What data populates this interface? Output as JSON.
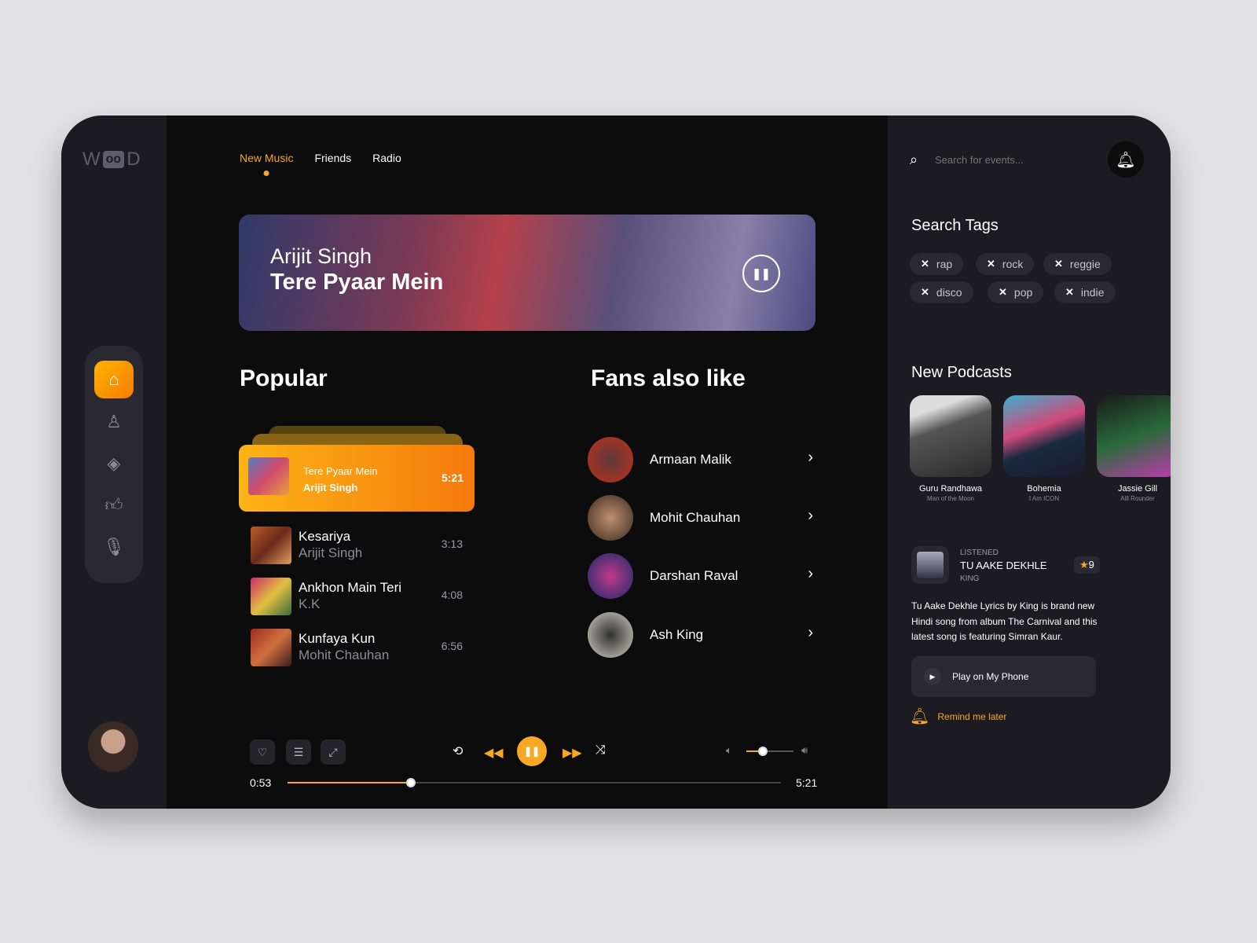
{
  "brand": {
    "logo": "WOOD",
    "colors": {
      "accent": "#f9a825",
      "panel": "#1c1b22",
      "main": "#0c0c0d"
    }
  },
  "sidebar": {
    "items": [
      {
        "icon": "home-icon",
        "active": true
      },
      {
        "icon": "user-icon"
      },
      {
        "icon": "layers-icon"
      },
      {
        "icon": "thumbs-up-icon"
      },
      {
        "icon": "microphone-icon"
      }
    ]
  },
  "tabs": [
    "New Music",
    "Friends",
    "Radio"
  ],
  "banner": {
    "artist": "Arijit Singh",
    "title": "Tere Pyaar Mein"
  },
  "popular": {
    "title": "Popular",
    "current": {
      "name": "Tere Pyaar Mein",
      "artist": "Arijit Singh",
      "duration": "5:21"
    },
    "songs": [
      {
        "name": "Kesariya",
        "artist": "Arijit Singh",
        "duration": "3:13"
      },
      {
        "name": "Ankhon Main Teri",
        "artist": "K.K",
        "duration": "4:08"
      },
      {
        "name": "Kunfaya Kun",
        "artist": "Mohit Chauhan",
        "duration": "6:56"
      }
    ]
  },
  "fans": {
    "title": "Fans also like",
    "items": [
      "Armaan Malik",
      "Mohit Chauhan",
      "Darshan Raval",
      "Ash King"
    ]
  },
  "player": {
    "elapsed": "0:53",
    "total": "5:21",
    "progress": 0.25,
    "volume": 0.35
  },
  "right": {
    "search_placeholder": "Search for events...",
    "tags_title": "Search Tags",
    "tags": [
      "rap",
      "rock",
      "reggie",
      "disco",
      "pop",
      "indie"
    ],
    "podcasts_title": "New Podcasts",
    "podcasts": [
      {
        "name": "Guru Randhawa",
        "sub": "Man of the Moon"
      },
      {
        "name": "Bohemia",
        "sub": "I Am ICON"
      },
      {
        "name": "Jassie Gill",
        "sub": "Alll Rounder"
      }
    ],
    "listened": {
      "label": "LISTENED",
      "title": "TU AAKE DEKHLE",
      "artist": "KING",
      "rating": "9",
      "description": "Tu Aake Dekhle Lyrics by King is brand new Hindi song from album The Carnival and this latest song is featuring Simran Kaur."
    },
    "play_label": "Play on My Phone",
    "remind_label": "Remind me later"
  }
}
